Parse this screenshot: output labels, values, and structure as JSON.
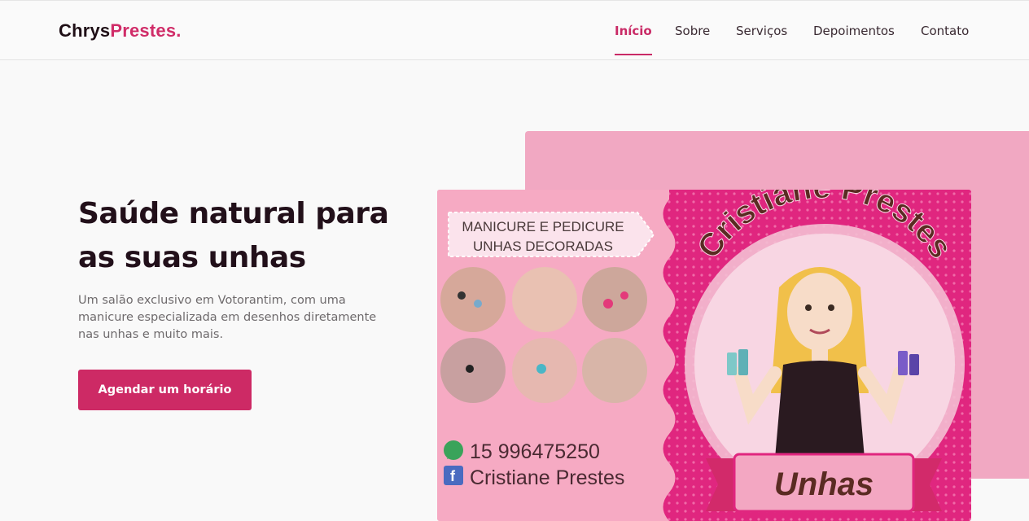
{
  "header": {
    "logo_part1": "Chrys",
    "logo_part2": "Prestes."
  },
  "nav": [
    {
      "label": "Início",
      "active": true
    },
    {
      "label": "Sobre",
      "active": false
    },
    {
      "label": "Serviços",
      "active": false
    },
    {
      "label": "Depoimentos",
      "active": false
    },
    {
      "label": "Contato",
      "active": false
    }
  ],
  "hero": {
    "title": "Saúde natural para as suas unhas",
    "subtitle": "Um salão exclusivo em Votorantim, com uma manicure especializada em desenhos diretamente nas unhas e muito mais.",
    "cta_label": "Agendar um horário"
  },
  "card": {
    "ribbon_line1": "MANICURE E PEDICURE",
    "ribbon_line2": "UNHAS DECORADAS",
    "arc_text": "Cristiane Prestes",
    "phone": "15 996475250",
    "facebook": "Cristiane Prestes",
    "banner_text": "Unhas"
  },
  "colors": {
    "brand": "#d02c68",
    "deco_block": "#f1a8c2",
    "card_magenta": "#e0267f"
  }
}
